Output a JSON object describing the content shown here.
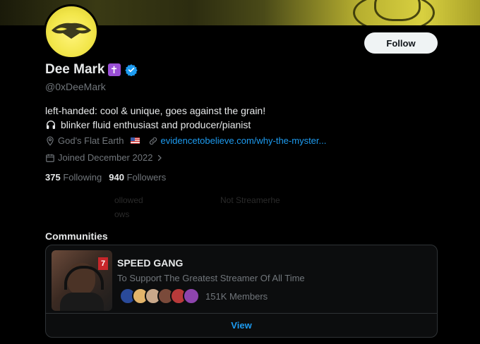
{
  "profile": {
    "name": "Dee Mark",
    "name_emoji": "✝",
    "handle": "@0xDeeMark",
    "follow_label": "Follow",
    "bio_line1": "left-handed: cool & unique, goes against the grain!",
    "bio_line2": "blinker fluid enthusiast and producer/pianist",
    "location": "God's Flat Earth",
    "website": "evidencetobelieve.com/why-the-myster...",
    "joined": "Joined December 2022",
    "following_count": "375",
    "following_label": "Following",
    "followers_count": "940",
    "followers_label": "Followers"
  },
  "ghost_text": {
    "left": "ollowed",
    "left2": "ows",
    "right": "Not Streamerhe"
  },
  "communities": {
    "title": "Communities",
    "card": {
      "name": "SPEED GANG",
      "description": "To Support The Greatest Streamer Of All Time",
      "members": "151K Members",
      "view_label": "View",
      "thumb_tag": "7"
    }
  },
  "colors": {
    "accent": "#1d9bf0",
    "verified": "#1d9bf0",
    "background": "#000000",
    "text_primary": "#e7e9ea",
    "text_secondary": "#71767b"
  },
  "icons": {
    "verified": "verified-badge-icon",
    "headphones": "headphones-icon",
    "location": "location-pin-icon",
    "link": "link-icon",
    "calendar": "calendar-icon",
    "chevron": "chevron-right-icon"
  }
}
